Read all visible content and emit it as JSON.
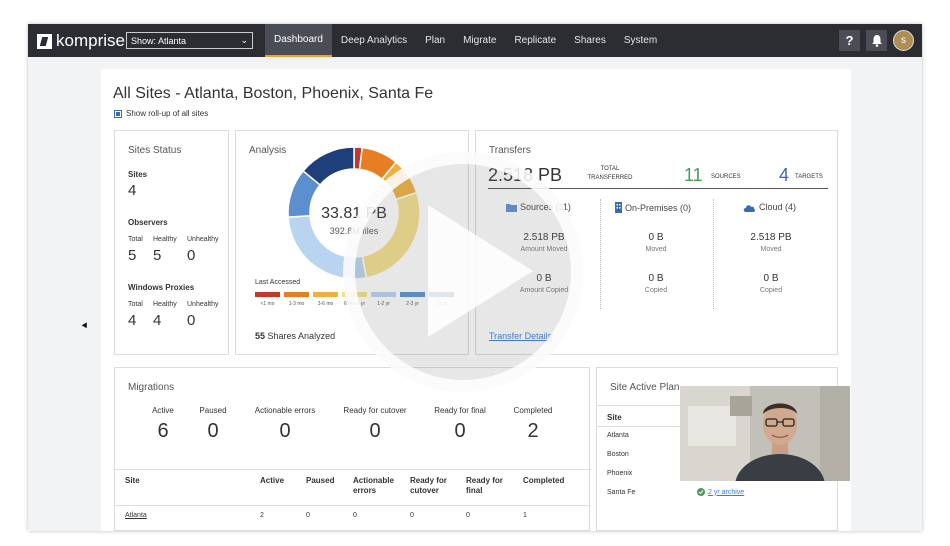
{
  "app": {
    "brand": "komprise",
    "site_selector": "Show: Atlanta",
    "nav": [
      "Dashboard",
      "Deep Analytics",
      "Plan",
      "Migrate",
      "Replicate",
      "Shares",
      "System"
    ],
    "help_icon_label": "?",
    "avatar_initial": "s",
    "accent": "#f0a030"
  },
  "page": {
    "title": "All Sites - Atlanta, Boston, Phoenix, Santa Fe",
    "rollup_label": "Show roll-up of all sites"
  },
  "sites_status": {
    "title": "Sites Status",
    "sites_label": "Sites",
    "sites_value": "4",
    "observers_label": "Observers",
    "observers": {
      "total_label": "Total",
      "healthy_label": "Healthy",
      "unhealthy_label": "Unhealthy",
      "total": "5",
      "healthy": "5",
      "unhealthy": "0"
    },
    "proxies_label": "Windows Proxies",
    "proxies": {
      "total_label": "Total",
      "healthy_label": "Healthy",
      "unhealthy_label": "Unhealthy",
      "total": "4",
      "healthy": "4",
      "unhealthy": "0"
    }
  },
  "analysis": {
    "title": "Analysis",
    "total": "33.81 PB",
    "files": "392.8M files",
    "last_accessed_label": "Last Accessed",
    "legend": [
      {
        "label": "<1 mo",
        "color": "#c0392b"
      },
      {
        "label": "1-3 mo",
        "color": "#e67e22"
      },
      {
        "label": "3-6 mo",
        "color": "#f0b040"
      },
      {
        "label": "6 mo-1 yr",
        "color": "#f5e08a"
      },
      {
        "label": "1-2 yr",
        "color": "#b8d4f0"
      },
      {
        "label": "2-3 yr",
        "color": "#5b8fd0"
      },
      {
        "label": ">3 yr",
        "color": "#1f3f7a"
      }
    ],
    "shares_count": "55",
    "shares_label": "Shares Analyzed"
  },
  "chart_data": {
    "type": "pie",
    "categories": [
      "<1 mo",
      "1-3 mo",
      "3-6 mo",
      "6 mo-1 yr",
      "1-2 yr",
      "2-3 yr",
      ">3 yr"
    ],
    "values": [
      2,
      9,
      9,
      27,
      27,
      12,
      14
    ],
    "colors": [
      "#c0392b",
      "#e67e22",
      "#f0b040",
      "#f5e08a",
      "#b8d4f0",
      "#5b8fd0",
      "#1f3f7a"
    ]
  },
  "transfers": {
    "title": "Transfers",
    "total": "2.518 PB",
    "total_label": "TOTAL TRANSFERRED",
    "sources_count": "11",
    "sources_label": "SOURCES",
    "targets_count": "4",
    "targets_label": "TARGETS",
    "columns": [
      {
        "name": "Sources (11)",
        "moved": "2.518 PB",
        "moved_label": "Amount Moved",
        "copied": "0 B",
        "copied_label": "Amount Copied"
      },
      {
        "name": "On-Premises (0)",
        "moved": "0 B",
        "moved_label": "Moved",
        "copied": "0 B",
        "copied_label": "Copied"
      },
      {
        "name": "Cloud (4)",
        "moved": "2.518 PB",
        "moved_label": "Moved",
        "copied": "0 B",
        "copied_label": "Copied"
      }
    ],
    "details_link": "Transfer Details"
  },
  "migrations": {
    "title": "Migrations",
    "stats": [
      {
        "label": "Active",
        "value": "6"
      },
      {
        "label": "Paused",
        "value": "0"
      },
      {
        "label": "Actionable errors",
        "value": "0"
      },
      {
        "label": "Ready for cutover",
        "value": "0"
      },
      {
        "label": "Ready for final",
        "value": "0"
      },
      {
        "label": "Completed",
        "value": "2"
      }
    ],
    "table_headers": [
      "Site",
      "Active",
      "Paused",
      "Actionable errors",
      "Ready for cutover",
      "Ready for final",
      "Completed"
    ],
    "rows": [
      [
        "Atlanta",
        "2",
        "0",
        "0",
        "0",
        "0",
        "1"
      ]
    ]
  },
  "site_plans": {
    "title": "Site Active Plan",
    "header": "Site",
    "sites": [
      "Atlanta",
      "Boston",
      "Phoenix",
      "Santa Fe"
    ],
    "santa_fe_plan": "2 yr archive"
  }
}
